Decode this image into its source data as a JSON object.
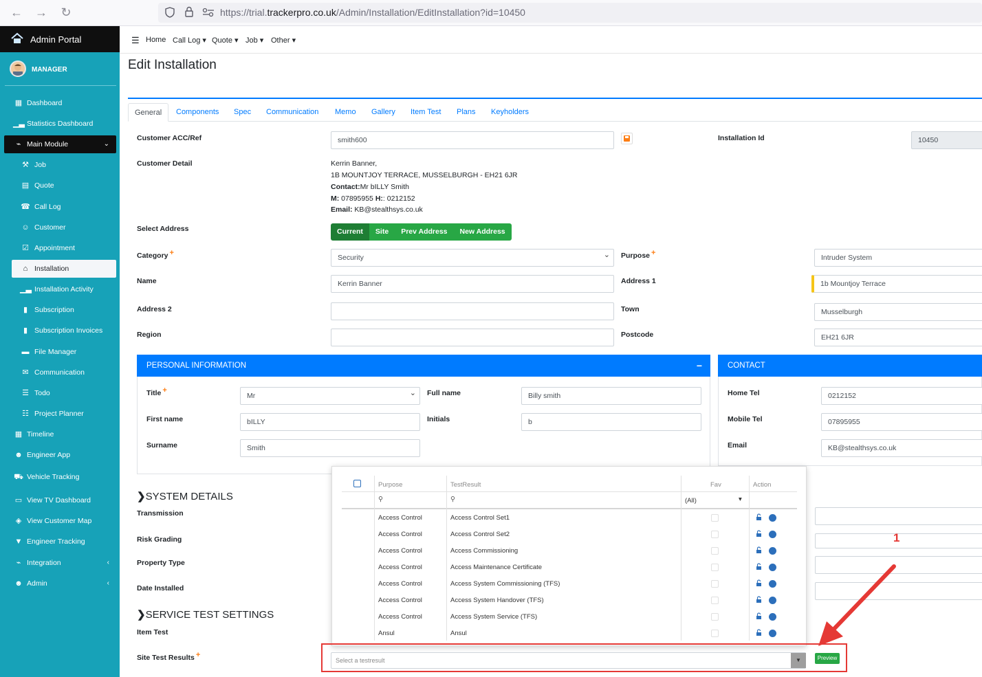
{
  "browser": {
    "url_prefix": "https://trial.",
    "url_domain": "trackerpro.co.uk",
    "url_path": "/Admin/Installation/EditInstallation?id=10450"
  },
  "brand": {
    "title": "Admin Portal"
  },
  "user": {
    "name": "MANAGER"
  },
  "sidebar": {
    "items": [
      {
        "label": "Dashboard",
        "icon": "grid-icon"
      },
      {
        "label": "Statistics Dashboard",
        "icon": "bar-chart-icon"
      },
      {
        "label": "Main Module",
        "icon": "plug-icon"
      },
      {
        "label": "Job",
        "icon": "wrench-icon"
      },
      {
        "label": "Quote",
        "icon": "calculator-icon"
      },
      {
        "label": "Call Log",
        "icon": "user-phone-icon"
      },
      {
        "label": "Customer",
        "icon": "users-icon"
      },
      {
        "label": "Appointment",
        "icon": "calendar-check-icon"
      },
      {
        "label": "Installation",
        "icon": "home-icon"
      },
      {
        "label": "Installation Activity",
        "icon": "bar-chart-icon"
      },
      {
        "label": "Subscription",
        "icon": "file-icon"
      },
      {
        "label": "Subscription Invoices",
        "icon": "file-icon"
      },
      {
        "label": "File Manager",
        "icon": "folder-icon"
      },
      {
        "label": "Communication",
        "icon": "envelope-icon"
      },
      {
        "label": "Todo",
        "icon": "list-icon"
      },
      {
        "label": "Project Planner",
        "icon": "sitemap-icon"
      },
      {
        "label": "Timeline",
        "icon": "calendar-icon"
      },
      {
        "label": "Engineer App",
        "icon": "user-cog-icon"
      },
      {
        "label": "Vehicle Tracking",
        "icon": "vehicle-icon"
      },
      {
        "label": "View TV Dashboard",
        "icon": "tv-icon"
      },
      {
        "label": "View Customer Map",
        "icon": "map-icon"
      },
      {
        "label": "Engineer Tracking",
        "icon": "map-marker-icon"
      },
      {
        "label": "Integration",
        "icon": "plug-icon"
      },
      {
        "label": "Admin",
        "icon": "users-cog-icon"
      }
    ]
  },
  "topnav": {
    "home": "Home",
    "calllog": "Call Log",
    "quote": "Quote",
    "job": "Job",
    "other": "Other"
  },
  "page": {
    "title": "Edit Installation"
  },
  "tabs": [
    "General",
    "Components",
    "Spec",
    "Communication",
    "Memo",
    "Gallery",
    "Item Test",
    "Plans",
    "Keyholders"
  ],
  "form": {
    "customer_acc_label": "Customer ACC/Ref",
    "customer_acc_value": "smith600",
    "installation_id_label": "Installation Id",
    "installation_id_value": "10450",
    "customer_detail_label": "Customer Detail",
    "detail_line1": "Kerrin Banner,",
    "detail_line2": "1B MOUNTJOY TERRACE, MUSSELBURGH - EH21 6JR",
    "detail_contact_label": "Contact:",
    "detail_contact_value": "Mr bILLY Smith",
    "detail_m_label": "M:",
    "detail_m_value": " 07895955 ",
    "detail_h_label": "H:",
    "detail_h_value": ": 0212152",
    "detail_email_label": "Email:",
    "detail_email_value": " KB@stealthsys.co.uk",
    "select_address_label": "Select Address",
    "address_buttons": [
      "Current",
      "Site",
      "Prev Address",
      "New Address"
    ],
    "category_label": "Category",
    "category_value": "Security",
    "purpose_label": "Purpose",
    "purpose_value": "Intruder System",
    "name_label": "Name",
    "name_value": "Kerrin Banner",
    "address1_label": "Address 1",
    "address1_value": "1b Mountjoy Terrace",
    "address2_label": "Address 2",
    "address2_value": "",
    "town_label": "Town",
    "town_value": "Musselburgh",
    "region_label": "Region",
    "region_value": "",
    "postcode_label": "Postcode",
    "postcode_value": "EH21 6JR"
  },
  "personal": {
    "header": "PERSONAL INFORMATION",
    "collapse": "−",
    "title_label": "Title",
    "title_value": "Mr",
    "fullname_label": "Full name",
    "fullname_value": "Billy smith",
    "firstname_label": "First name",
    "firstname_value": "bILLY",
    "initials_label": "Initials",
    "initials_value": "b",
    "surname_label": "Surname",
    "surname_value": "Smith"
  },
  "contact": {
    "header": "CONTACT",
    "hometel_label": "Home Tel",
    "hometel_value": "0212152",
    "mobile_label": "Mobile Tel",
    "mobile_value": "07895955",
    "email_label": "Email",
    "email_value": "KB@stealthsys.co.uk"
  },
  "system": {
    "header": "SYSTEM DETAILS",
    "transmission": "Transmission",
    "risk": "Risk Grading",
    "property": "Property Type",
    "date": "Date Installed"
  },
  "service": {
    "header": "SERVICE TEST SETTINGS",
    "item_test": "Item Test",
    "site_results": "Site Test Results"
  },
  "annotation": {
    "number": "1"
  },
  "grid": {
    "headers": {
      "purpose": "Purpose",
      "testresult": "TestResult",
      "fav": "Fav",
      "action": "Action"
    },
    "fav_filter": "(All)",
    "rows": [
      {
        "purpose": "Access Control",
        "result": "Access Control Set1"
      },
      {
        "purpose": "Access Control",
        "result": "Access Control Set2"
      },
      {
        "purpose": "Access Control",
        "result": "Access Commissioning"
      },
      {
        "purpose": "Access Control",
        "result": "Access Maintenance Certificate"
      },
      {
        "purpose": "Access Control",
        "result": "Access System Commissioning (TFS)"
      },
      {
        "purpose": "Access Control",
        "result": "Access System Handover (TFS)"
      },
      {
        "purpose": "Access Control",
        "result": "Access System Service (TFS)"
      },
      {
        "purpose": "Ansul",
        "result": "Ansul"
      }
    ]
  },
  "testresult_select": {
    "placeholder": "Select a testresult"
  },
  "preview": {
    "label": "Preview"
  },
  "colors": {
    "sidebar": "#17a2b8",
    "primary": "#007bff",
    "success": "#28a745",
    "annotation": "#e53935"
  }
}
